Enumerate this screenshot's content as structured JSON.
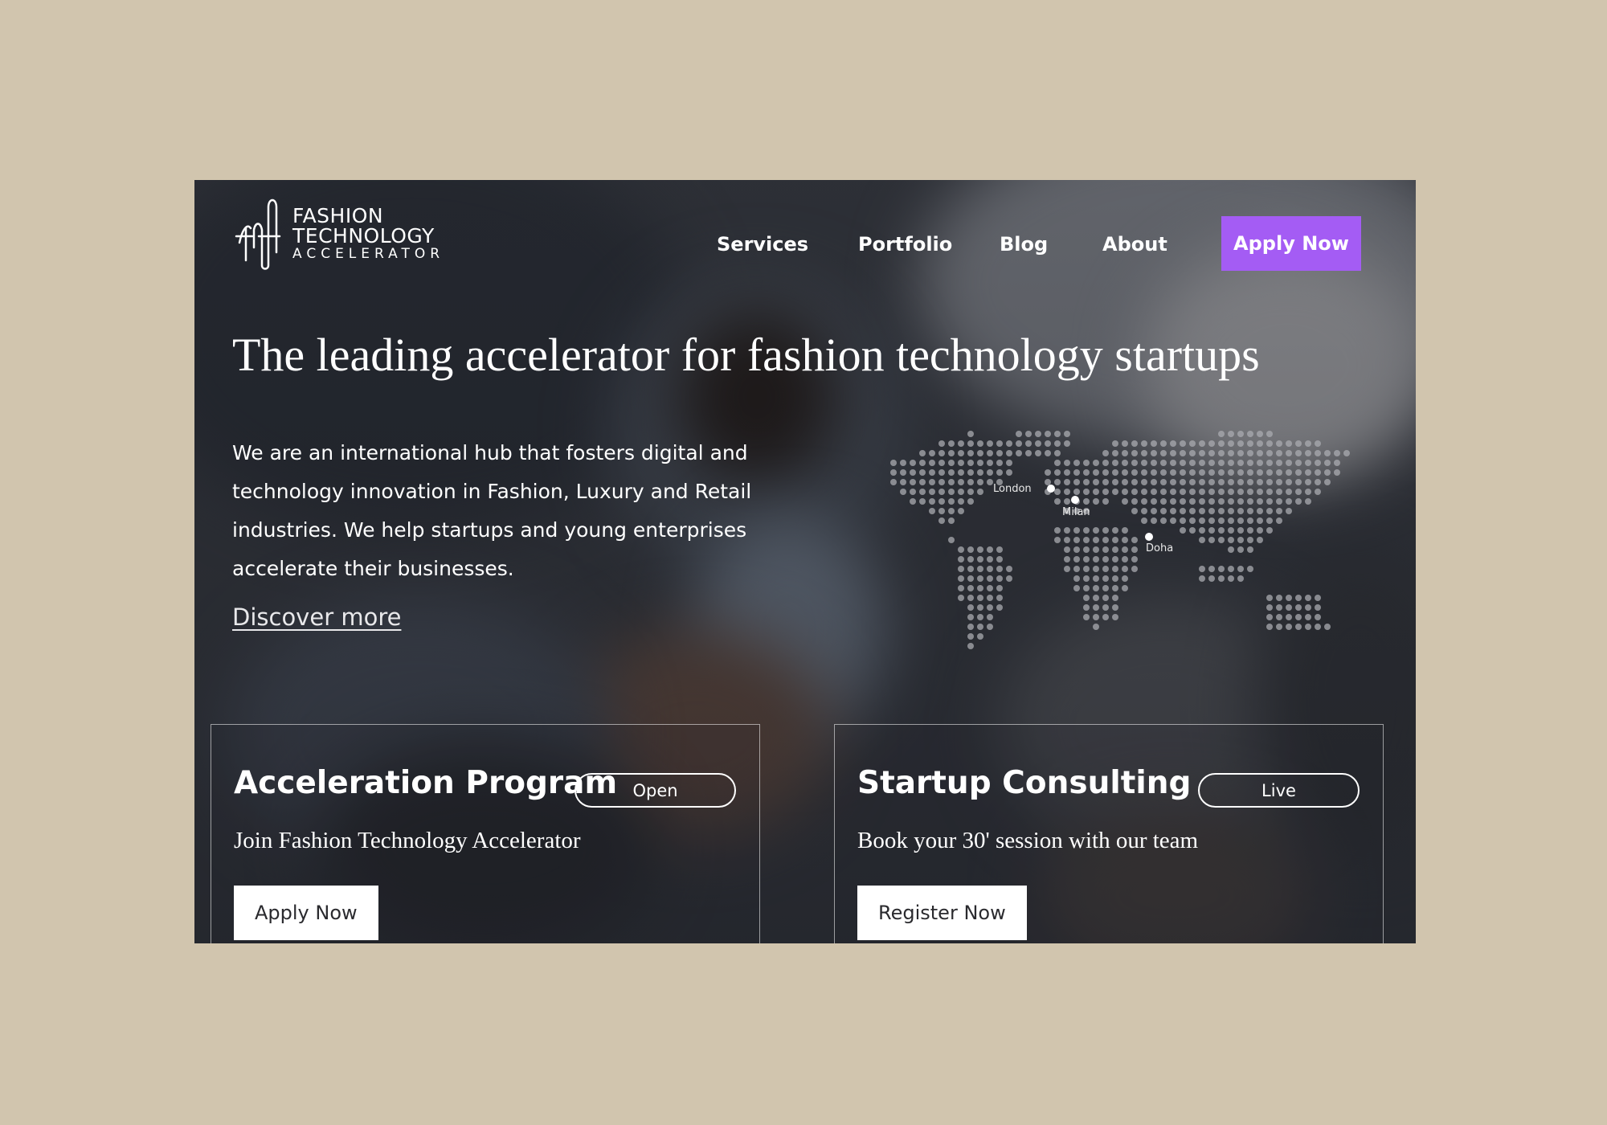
{
  "logo": {
    "line1": "FASHION",
    "line2": "TECHNOLOGY",
    "line3": "ACCELERATOR"
  },
  "nav": {
    "items": [
      "Services",
      "Portfolio",
      "Blog",
      "About"
    ],
    "cta": "Apply Now"
  },
  "hero": {
    "headline": "The leading accelerator for fashion technology startups",
    "intro": "We are an international hub that fosters digital and technology innovation in Fashion, Luxury and Retail industries. We help startups and young enterprises accelerate their businesses.",
    "link": "Discover more"
  },
  "map": {
    "cities": [
      "London",
      "Milan",
      "Doha"
    ]
  },
  "cards": [
    {
      "title": "Acceleration Program",
      "badge": "Open",
      "subtitle": "Join Fashion Technology Accelerator",
      "button": "Apply Now"
    },
    {
      "title": "Startup Consulting",
      "badge": "Live",
      "subtitle": "Book your 30' session with our team",
      "button": "Register Now"
    }
  ],
  "colors": {
    "page_background": "#d1c5ae",
    "accent": "#a45cf4"
  }
}
